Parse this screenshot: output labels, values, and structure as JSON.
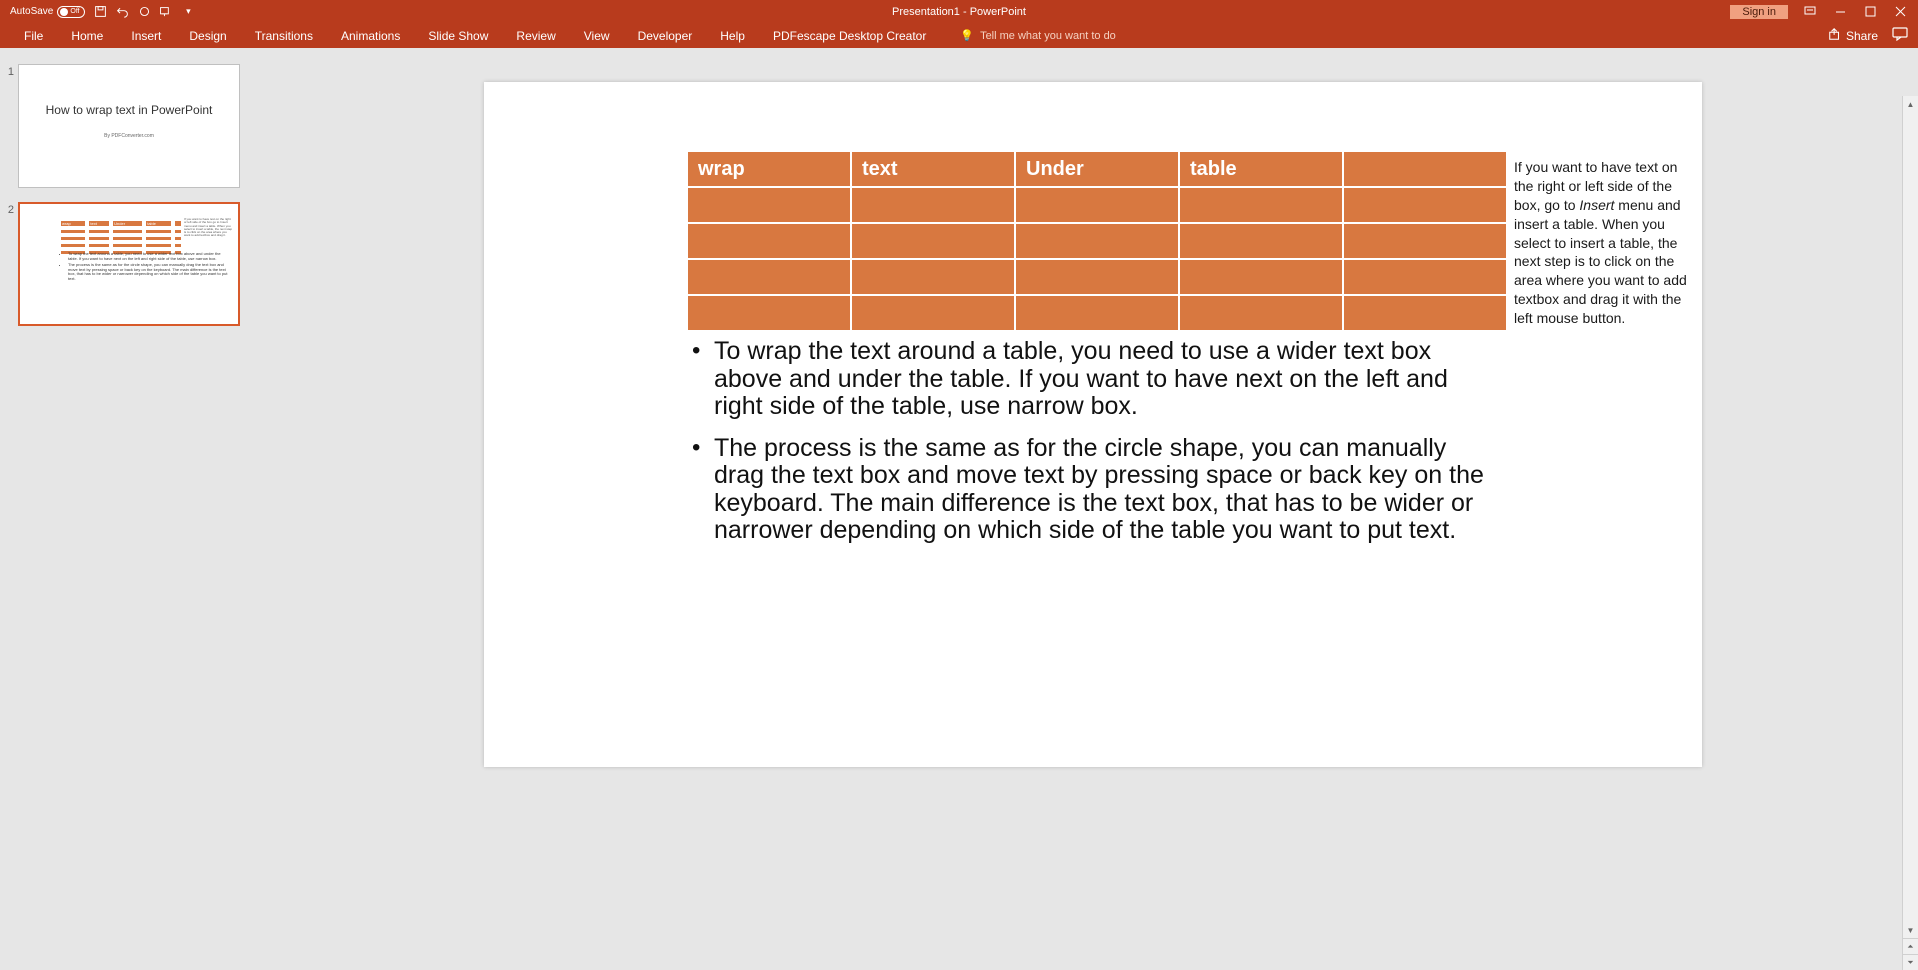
{
  "titlebar": {
    "autosave_label": "AutoSave",
    "autosave_state": "Off",
    "title": "Presentation1 - PowerPoint",
    "signin": "Sign in"
  },
  "ribbon": {
    "tabs": [
      "File",
      "Home",
      "Insert",
      "Design",
      "Transitions",
      "Animations",
      "Slide Show",
      "Review",
      "View",
      "Developer",
      "Help",
      "PDFescape Desktop Creator"
    ],
    "tellme": "Tell me what you want to do",
    "share": "Share"
  },
  "thumbnails": {
    "slide1_num": "1",
    "slide1_title": "How to wrap text in PowerPoint",
    "slide1_sub": "By PDFConverter.com",
    "slide2_num": "2"
  },
  "slide": {
    "table_headers": [
      "wrap",
      "text",
      "Under",
      "table",
      ""
    ],
    "side_text_pre": "If you want to have text on the right or left side of the box, go to ",
    "side_text_italic": "Insert",
    "side_text_post": " menu and insert a table. When you select to insert a table, the next step is to click on the area where you want to add textbox and drag it with the left mouse button.",
    "bullet1": "To wrap the text around a table, you need to use a wider text box above and under the table. If you want to have next on the left and right side of the table, use narrow box.",
    "bullet2": "The process is the same as for the circle shape, you can manually drag the text box and move text by pressing space or back key on the keyboard. The main difference is the text box, that has to be wider or narrower depending on which side of the table you want to put text."
  },
  "chart_data": {
    "type": "table",
    "columns": [
      "wrap",
      "text",
      "Under",
      "table",
      ""
    ],
    "rows": [
      [
        "",
        "",
        "",
        "",
        ""
      ],
      [
        "",
        "",
        "",
        "",
        ""
      ],
      [
        "",
        "",
        "",
        "",
        ""
      ],
      [
        "",
        "",
        "",
        "",
        ""
      ]
    ]
  }
}
